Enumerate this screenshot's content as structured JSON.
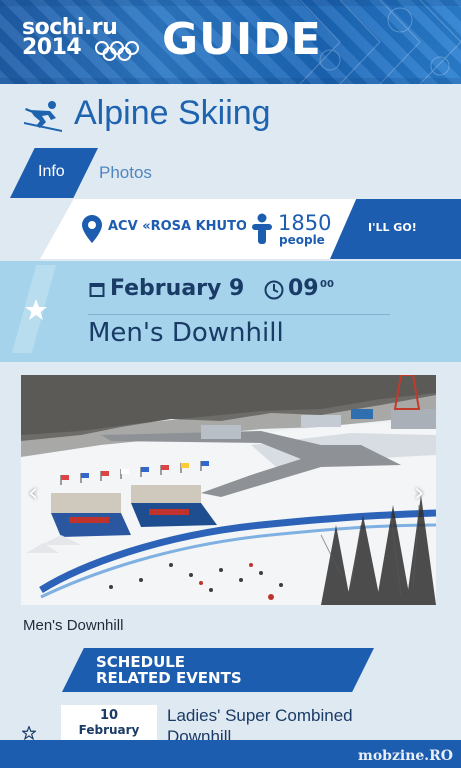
{
  "header": {
    "logo_line1": "sochi.ru",
    "logo_line2": "2014",
    "title": "GUIDE"
  },
  "sport": {
    "icon": "alpine-skier-icon",
    "title": "Alpine Skiing"
  },
  "tabs": [
    {
      "label": "Info",
      "active": true
    },
    {
      "label": "Photos",
      "active": false
    }
  ],
  "venue": {
    "icon": "map-pin-icon",
    "name": "ACV «ROSA KHUTOR»",
    "attendees_icon": "person-icon",
    "attendees_count": "1850",
    "attendees_label": "people",
    "go_button": "I'LL GO!"
  },
  "event": {
    "favorite_icon": "star-icon",
    "date_icon": "calendar-icon",
    "date": "February 9",
    "time_icon": "clock-icon",
    "time_hour": "09",
    "time_min": "00",
    "name": "Men's Downhill"
  },
  "photo": {
    "caption": "Men's Downhill",
    "prev_icon": "chevron-left-icon",
    "next_icon": "chevron-right-icon"
  },
  "schedule": {
    "line1": "SCHEDULE",
    "line2": "RELATED EVENTS"
  },
  "related_events": [
    {
      "day": "10",
      "month": "February",
      "title": "Ladies' Super Combined Downhill"
    }
  ],
  "app_bar": {
    "more_icon": "more-dots-icon",
    "watermark": "mobzine.RO"
  },
  "colors": {
    "brand_blue": "#1d5db0",
    "event_band": "#a4d3eb",
    "background": "#dfe9f2"
  }
}
